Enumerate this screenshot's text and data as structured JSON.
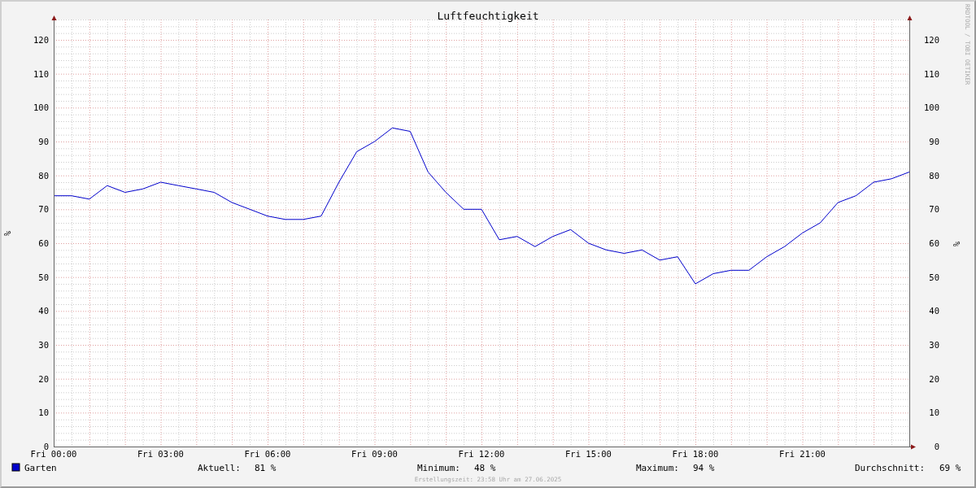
{
  "graph": {
    "title": "Luftfeuchtigkeit",
    "credit": "RRDTOOL / TOBI OETIKER",
    "chart_data": {
      "type": "line",
      "ylabel": "%",
      "ylim": [
        0,
        126
      ],
      "categories": [
        "Fri 00:00",
        null,
        null,
        null,
        null,
        null,
        "Fri 03:00",
        null,
        null,
        null,
        null,
        null,
        "Fri 06:00",
        null,
        null,
        null,
        null,
        null,
        "Fri 09:00",
        null,
        null,
        null,
        null,
        null,
        "Fri 12:00",
        null,
        null,
        null,
        null,
        null,
        "Fri 15:00",
        null,
        null,
        null,
        null,
        null,
        "Fri 18:00",
        null,
        null,
        null,
        null,
        null,
        "Fri 21:00",
        null,
        null,
        null,
        null,
        null,
        null
      ],
      "yticks": [
        0,
        10,
        20,
        30,
        40,
        50,
        60,
        70,
        80,
        90,
        100,
        110,
        120
      ],
      "grid": true,
      "series": [
        {
          "name": "Garten",
          "color": "#0000cc",
          "values": [
            74,
            74,
            73,
            77,
            75,
            76,
            78,
            77,
            76,
            75,
            72,
            70,
            68,
            67,
            67,
            68,
            78,
            87,
            90,
            94,
            93,
            81,
            75,
            70,
            70,
            61,
            62,
            59,
            62,
            64,
            60,
            58,
            57,
            58,
            55,
            56,
            48,
            51,
            52,
            52,
            56,
            59,
            63,
            66,
            72,
            74,
            78,
            79,
            81
          ]
        }
      ]
    },
    "right_axis": {
      "label": "%",
      "ticks": [
        "120",
        "110",
        "100",
        "90",
        "80",
        "70",
        "60",
        "50",
        "40",
        "30",
        "20",
        "10",
        "0"
      ]
    },
    "stats": [
      {
        "label": "Aktuell:",
        "value": "81 %"
      },
      {
        "label": "Minimum:",
        "value": "48 %"
      },
      {
        "label": "Maximum:",
        "value": "94 %"
      },
      {
        "label": "Durchschnitt:",
        "value": "69 %"
      }
    ],
    "footer": "Erstellungszeit: 23:58 Uhr am 27.06.2025"
  }
}
